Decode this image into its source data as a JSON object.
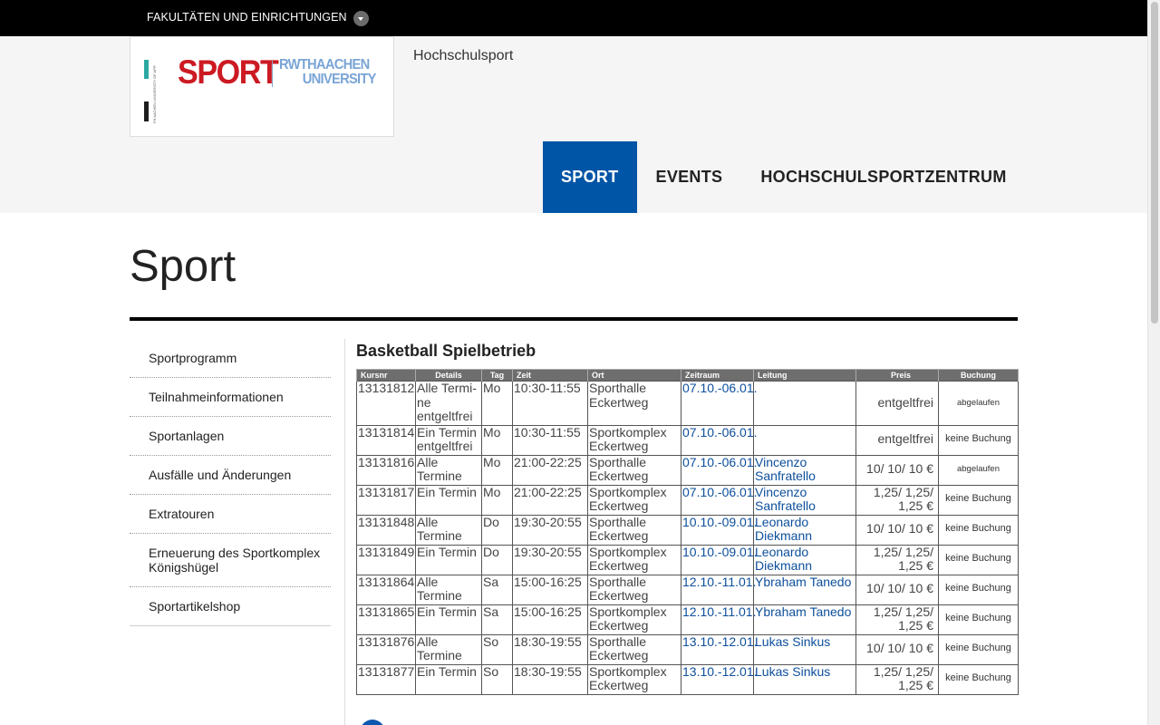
{
  "topbar": {
    "faculties_label": "FAKULTÄTEN UND EINRICHTUNGEN"
  },
  "header": {
    "logo_sport": "SPORT",
    "logo_rwth_line1": "RWTHAACHEN",
    "logo_rwth_line2": "UNIVERSITY",
    "logo_fh": "FH AACHEN UNIVERSITY OF APPLIED SCIENCES",
    "site_name": "Hochschulsport"
  },
  "nav": [
    {
      "label": "SPORT",
      "active": true
    },
    {
      "label": "EVENTS",
      "active": false
    },
    {
      "label": "HOCHSCHULSPORTZENTRUM",
      "active": false
    }
  ],
  "page_title": "Sport",
  "sidebar": {
    "items": [
      "Sportprogramm",
      "Teilnahmeinformationen",
      "Sportanlagen",
      "Ausfälle und Änderungen",
      "Extratouren",
      "Erneuerung des Sportkomplex Königshügel",
      "Sportartikelshop"
    ]
  },
  "course": {
    "title": "Basketball Spielbetrieb",
    "columns": [
      "Kursnr",
      "Details",
      "Tag",
      "Zeit",
      "Ort",
      "Zeitraum",
      "Leitung",
      "Preis",
      "Buchung"
    ],
    "rows": [
      {
        "nr": "13131812",
        "details": "Alle Termi-ne entgeltfrei",
        "tag": "Mo",
        "zeit": "10:30-11:55",
        "ort": "Sporthalle Eckertweg",
        "zeitraum": "07.10.-06.01.",
        "leitung": "",
        "preis": "entgeltfrei",
        "buchung": "abgelaufen"
      },
      {
        "nr": "13131814",
        "details": "Ein Termin entgeltfrei",
        "tag": "Mo",
        "zeit": "10:30-11:55",
        "ort": "Sportkomplex Eckertweg",
        "zeitraum": "07.10.-06.01.",
        "leitung": "",
        "preis": "entgeltfrei",
        "buchung": "keine Buchung"
      },
      {
        "nr": "13131816",
        "details": "Alle Termine",
        "tag": "Mo",
        "zeit": "21:00-22:25",
        "ort": "Sporthalle Eckertweg",
        "zeitraum": "07.10.-06.01.",
        "leitung": "Vincenzo Sanfratello",
        "preis": "10/ 10/ 10 €",
        "buchung": "abgelaufen"
      },
      {
        "nr": "13131817",
        "details": "Ein Termin",
        "tag": "Mo",
        "zeit": "21:00-22:25",
        "ort": "Sportkomplex Eckertweg",
        "zeitraum": "07.10.-06.01.",
        "leitung": "Vincenzo Sanfratello",
        "preis": "1,25/ 1,25/ 1,25 €",
        "buchung": "keine Buchung"
      },
      {
        "nr": "13131848",
        "details": "Alle Termine",
        "tag": "Do",
        "zeit": "19:30-20:55",
        "ort": "Sporthalle Eckertweg",
        "zeitraum": "10.10.-09.01.",
        "leitung": "Leonardo Diekmann",
        "preis": "10/ 10/ 10 €",
        "buchung": "keine Buchung"
      },
      {
        "nr": "13131849",
        "details": "Ein Termin",
        "tag": "Do",
        "zeit": "19:30-20:55",
        "ort": "Sportkomplex Eckertweg",
        "zeitraum": "10.10.-09.01.",
        "leitung": "Leonardo Diekmann",
        "preis": "1,25/ 1,25/ 1,25 €",
        "buchung": "keine Buchung"
      },
      {
        "nr": "13131864",
        "details": "Alle Termine",
        "tag": "Sa",
        "zeit": "15:00-16:25",
        "ort": "Sporthalle Eckertweg",
        "zeitraum": "12.10.-11.01.",
        "leitung": "Ybraham Tanedo",
        "preis": "10/ 10/ 10 €",
        "buchung": "keine Buchung"
      },
      {
        "nr": "13131865",
        "details": "Ein Termin",
        "tag": "Sa",
        "zeit": "15:00-16:25",
        "ort": "Sportkomplex Eckertweg",
        "zeitraum": "12.10.-11.01.",
        "leitung": "Ybraham Tanedo",
        "preis": "1,25/ 1,25/ 1,25 €",
        "buchung": "keine Buchung"
      },
      {
        "nr": "13131876",
        "details": "Alle Termine",
        "tag": "So",
        "zeit": "18:30-19:55",
        "ort": "Sporthalle Eckertweg",
        "zeitraum": "13.10.-12.01.",
        "leitung": "Lukas Sinkus",
        "preis": "10/ 10/ 10 €",
        "buchung": "keine Buchung"
      },
      {
        "nr": "13131877",
        "details": "Ein Termin",
        "tag": "So",
        "zeit": "18:30-19:55",
        "ort": "Sportkomplex Eckertweg",
        "zeitraum": "13.10.-12.01.",
        "leitung": "Lukas Sinkus",
        "preis": "1,25/ 1,25/ 1,25 €",
        "buchung": "keine Buchung"
      }
    ]
  },
  "colors": {
    "accent": "#0055a6",
    "brand_red": "#cc1a23",
    "link": "#0d4f9c"
  },
  "icons": {
    "faculty_toggle": "chevron-down-icon",
    "social": "facebook-icon"
  }
}
